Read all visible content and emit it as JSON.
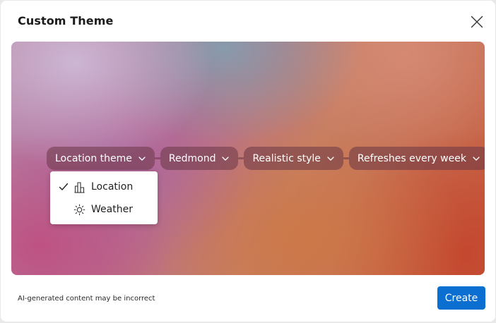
{
  "dialog": {
    "title": "Custom Theme",
    "close_icon": "close-icon"
  },
  "chips": [
    {
      "label": "Location theme",
      "icon": "chevron-down-icon"
    },
    {
      "label": "Redmond",
      "icon": "chevron-down-icon"
    },
    {
      "label": "Realistic style",
      "icon": "chevron-down-icon"
    },
    {
      "label": "Refreshes every week",
      "icon": "chevron-down-icon"
    }
  ],
  "dropdown": {
    "items": [
      {
        "label": "Location",
        "icon": "buildings-icon",
        "selected": true
      },
      {
        "label": "Weather",
        "icon": "sun-icon",
        "selected": false
      }
    ]
  },
  "footer": {
    "disclaimer": "AI-generated content may be incorrect",
    "create_label": "Create"
  },
  "colors": {
    "accent": "#0a6fd1",
    "chip_background": "rgba(105,55,70,0.55)"
  }
}
